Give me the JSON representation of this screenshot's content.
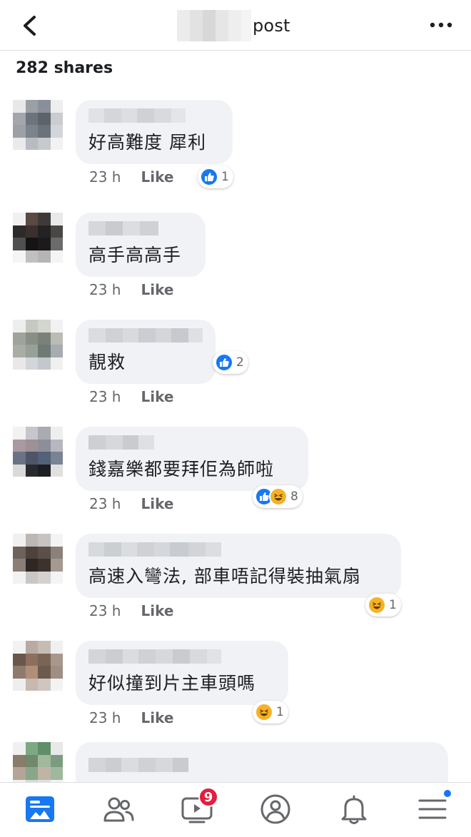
{
  "header": {
    "title_visible": "post",
    "back_icon": "chevron-left-icon",
    "more_icon": "more-horizontal-icon"
  },
  "shares_text": "282 shares",
  "comments": [
    {
      "text": "好高難度 犀利",
      "time": "23 h",
      "like_label": "Like",
      "reactions": [
        "like"
      ],
      "count": "1"
    },
    {
      "text": "高手高高手",
      "time": "23 h",
      "like_label": "Like",
      "reactions": [],
      "count": ""
    },
    {
      "text": "靚救",
      "time": "23 h",
      "like_label": "Like",
      "reactions": [
        "like"
      ],
      "count": "2"
    },
    {
      "text": "錢嘉樂都要拜佢為師啦",
      "time": "23 h",
      "like_label": "Like",
      "reactions": [
        "like",
        "haha"
      ],
      "count": "8"
    },
    {
      "text": "高速入彎法, 部車唔記得裝抽氣扇",
      "time": "23 h",
      "like_label": "Like",
      "reactions": [
        "haha"
      ],
      "count": "1"
    },
    {
      "text": "好似撞到片主車頭嗎",
      "time": "23 h",
      "like_label": "Like",
      "reactions": [
        "haha"
      ],
      "count": "1"
    }
  ],
  "tabbar": {
    "tabs": [
      {
        "icon": "news-feed-icon",
        "active": true
      },
      {
        "icon": "friends-icon"
      },
      {
        "icon": "watch-icon",
        "badge": "9"
      },
      {
        "icon": "profile-icon"
      },
      {
        "icon": "notifications-bell-icon"
      },
      {
        "icon": "menu-icon",
        "dot": true
      }
    ]
  },
  "colors": {
    "accent": "#1877f2",
    "bubble": "#f0f2f5",
    "meta_text": "#65676b",
    "badge": "#e41e3f",
    "haha": "#f7b125"
  }
}
